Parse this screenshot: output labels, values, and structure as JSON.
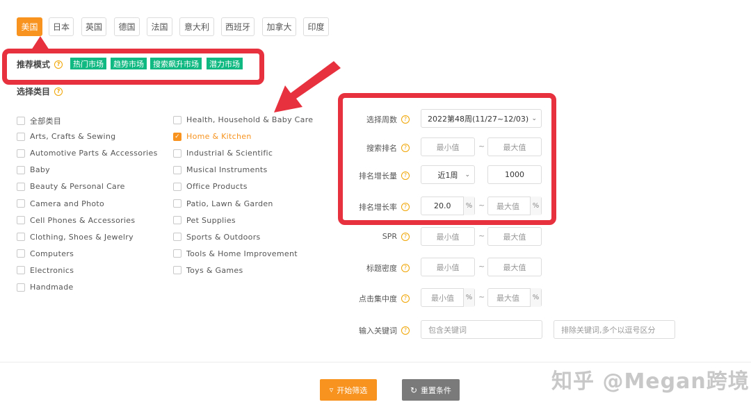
{
  "countries": [
    "美国",
    "日本",
    "英国",
    "德国",
    "法国",
    "意大利",
    "西班牙",
    "加拿大",
    "印度"
  ],
  "recommend": {
    "label": "推荐模式",
    "modes": [
      "热门市场",
      "趋势市场",
      "搜索飙升市场",
      "潜力市场"
    ]
  },
  "category": {
    "label": "选择类目",
    "col1": [
      "全部类目",
      "Arts, Crafts & Sewing",
      "Automotive Parts & Accessories",
      "Baby",
      "Beauty & Personal Care",
      "Camera and Photo",
      "Cell Phones & Accessories",
      "Clothing, Shoes & Jewelry",
      "Computers",
      "Electronics",
      "Handmade"
    ],
    "col2": [
      "Health, Household & Baby Care",
      "Home & Kitchen",
      "Industrial & Scientific",
      "Musical Instruments",
      "Office Products",
      "Patio, Lawn & Garden",
      "Pet Supplies",
      "Sports & Outdoors",
      "Tools & Home Improvement",
      "Toys & Games"
    ],
    "checked": "Home & Kitchen"
  },
  "filters": {
    "week_label": "选择周数",
    "week_value": "2022第48周(11/27~12/03)",
    "search_rank_label": "搜索排名",
    "rank_growth_label": "排名增长量",
    "rank_growth_period": "近1周",
    "rank_growth_value": "1000",
    "rank_rate_label": "排名增长率",
    "rank_rate_value": "20.0",
    "spr_label": "SPR",
    "title_density_label": "标题密度",
    "click_conc_label": "点击集中度",
    "keyword_label": "输入关键词",
    "min_placeholder": "最小值",
    "max_placeholder": "最大值",
    "percent": "%",
    "tilde": "~",
    "include_placeholder": "包含关键词",
    "exclude_placeholder": "排除关键词,多个以逗号区分"
  },
  "buttons": {
    "start": "开始筛选",
    "reset": "重置条件"
  },
  "watermark": "知乎 @Megan跨境",
  "colors": {
    "accent": "#f7931e",
    "tag": "#10b981",
    "highlight": "#e8313f",
    "reset": "#7a7a7a"
  }
}
